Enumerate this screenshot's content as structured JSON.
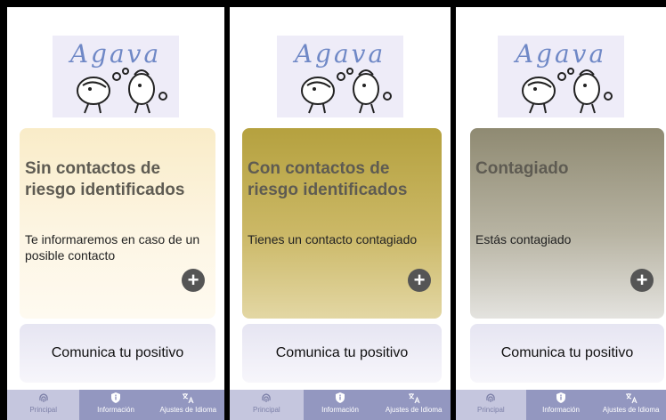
{
  "logo": {
    "text": "Agava"
  },
  "screens": [
    {
      "title": "Sin contactos de riesgo identificados",
      "text": "Te informaremos en caso de un posible contacto",
      "plus_label": "+",
      "report_label": "Comunica tu positivo"
    },
    {
      "title": "Con contactos de riesgo identificados",
      "text": "Tienes un contacto contagiado",
      "plus_label": "+",
      "report_label": "Comunica tu positivo"
    },
    {
      "title": "Contagiado",
      "text": "Estás contagiado",
      "plus_label": "+",
      "report_label": "Comunica tu positivo"
    }
  ],
  "nav": {
    "home": "Principal",
    "info": "Información",
    "language": "Ajustes de Idioma"
  },
  "colors": {
    "nav_bg": "#9397c0",
    "nav_active": "#c5c6de",
    "card_none": "#f9ecc8",
    "card_contact": "#b5a13f",
    "card_infected": "#8f8a72"
  },
  "icons": [
    "fingerprint-icon",
    "shield-icon",
    "translate-icon",
    "plus-icon"
  ]
}
